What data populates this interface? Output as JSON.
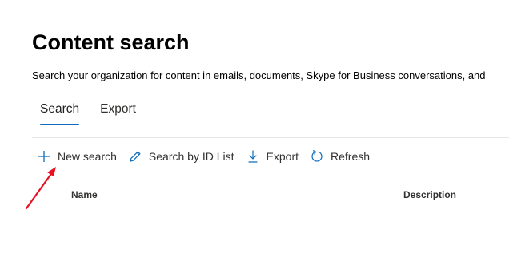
{
  "page": {
    "title": "Content search",
    "description": "Search your organization for content in emails, documents, Skype for Business conversations, and"
  },
  "tabs": [
    {
      "label": "Search",
      "active": true
    },
    {
      "label": "Export",
      "active": false
    }
  ],
  "toolbar": {
    "new_search": {
      "label": "New search",
      "icon": "plus-icon"
    },
    "search_by_id": {
      "label": "Search by ID List",
      "icon": "pencil-icon"
    },
    "export": {
      "label": "Export",
      "icon": "download-arrow-icon"
    },
    "refresh": {
      "label": "Refresh",
      "icon": "refresh-icon"
    }
  },
  "table": {
    "columns": [
      "Name",
      "Description"
    ]
  },
  "colors": {
    "accent": "#0f6cbd",
    "annotation_arrow": "#e81123"
  }
}
